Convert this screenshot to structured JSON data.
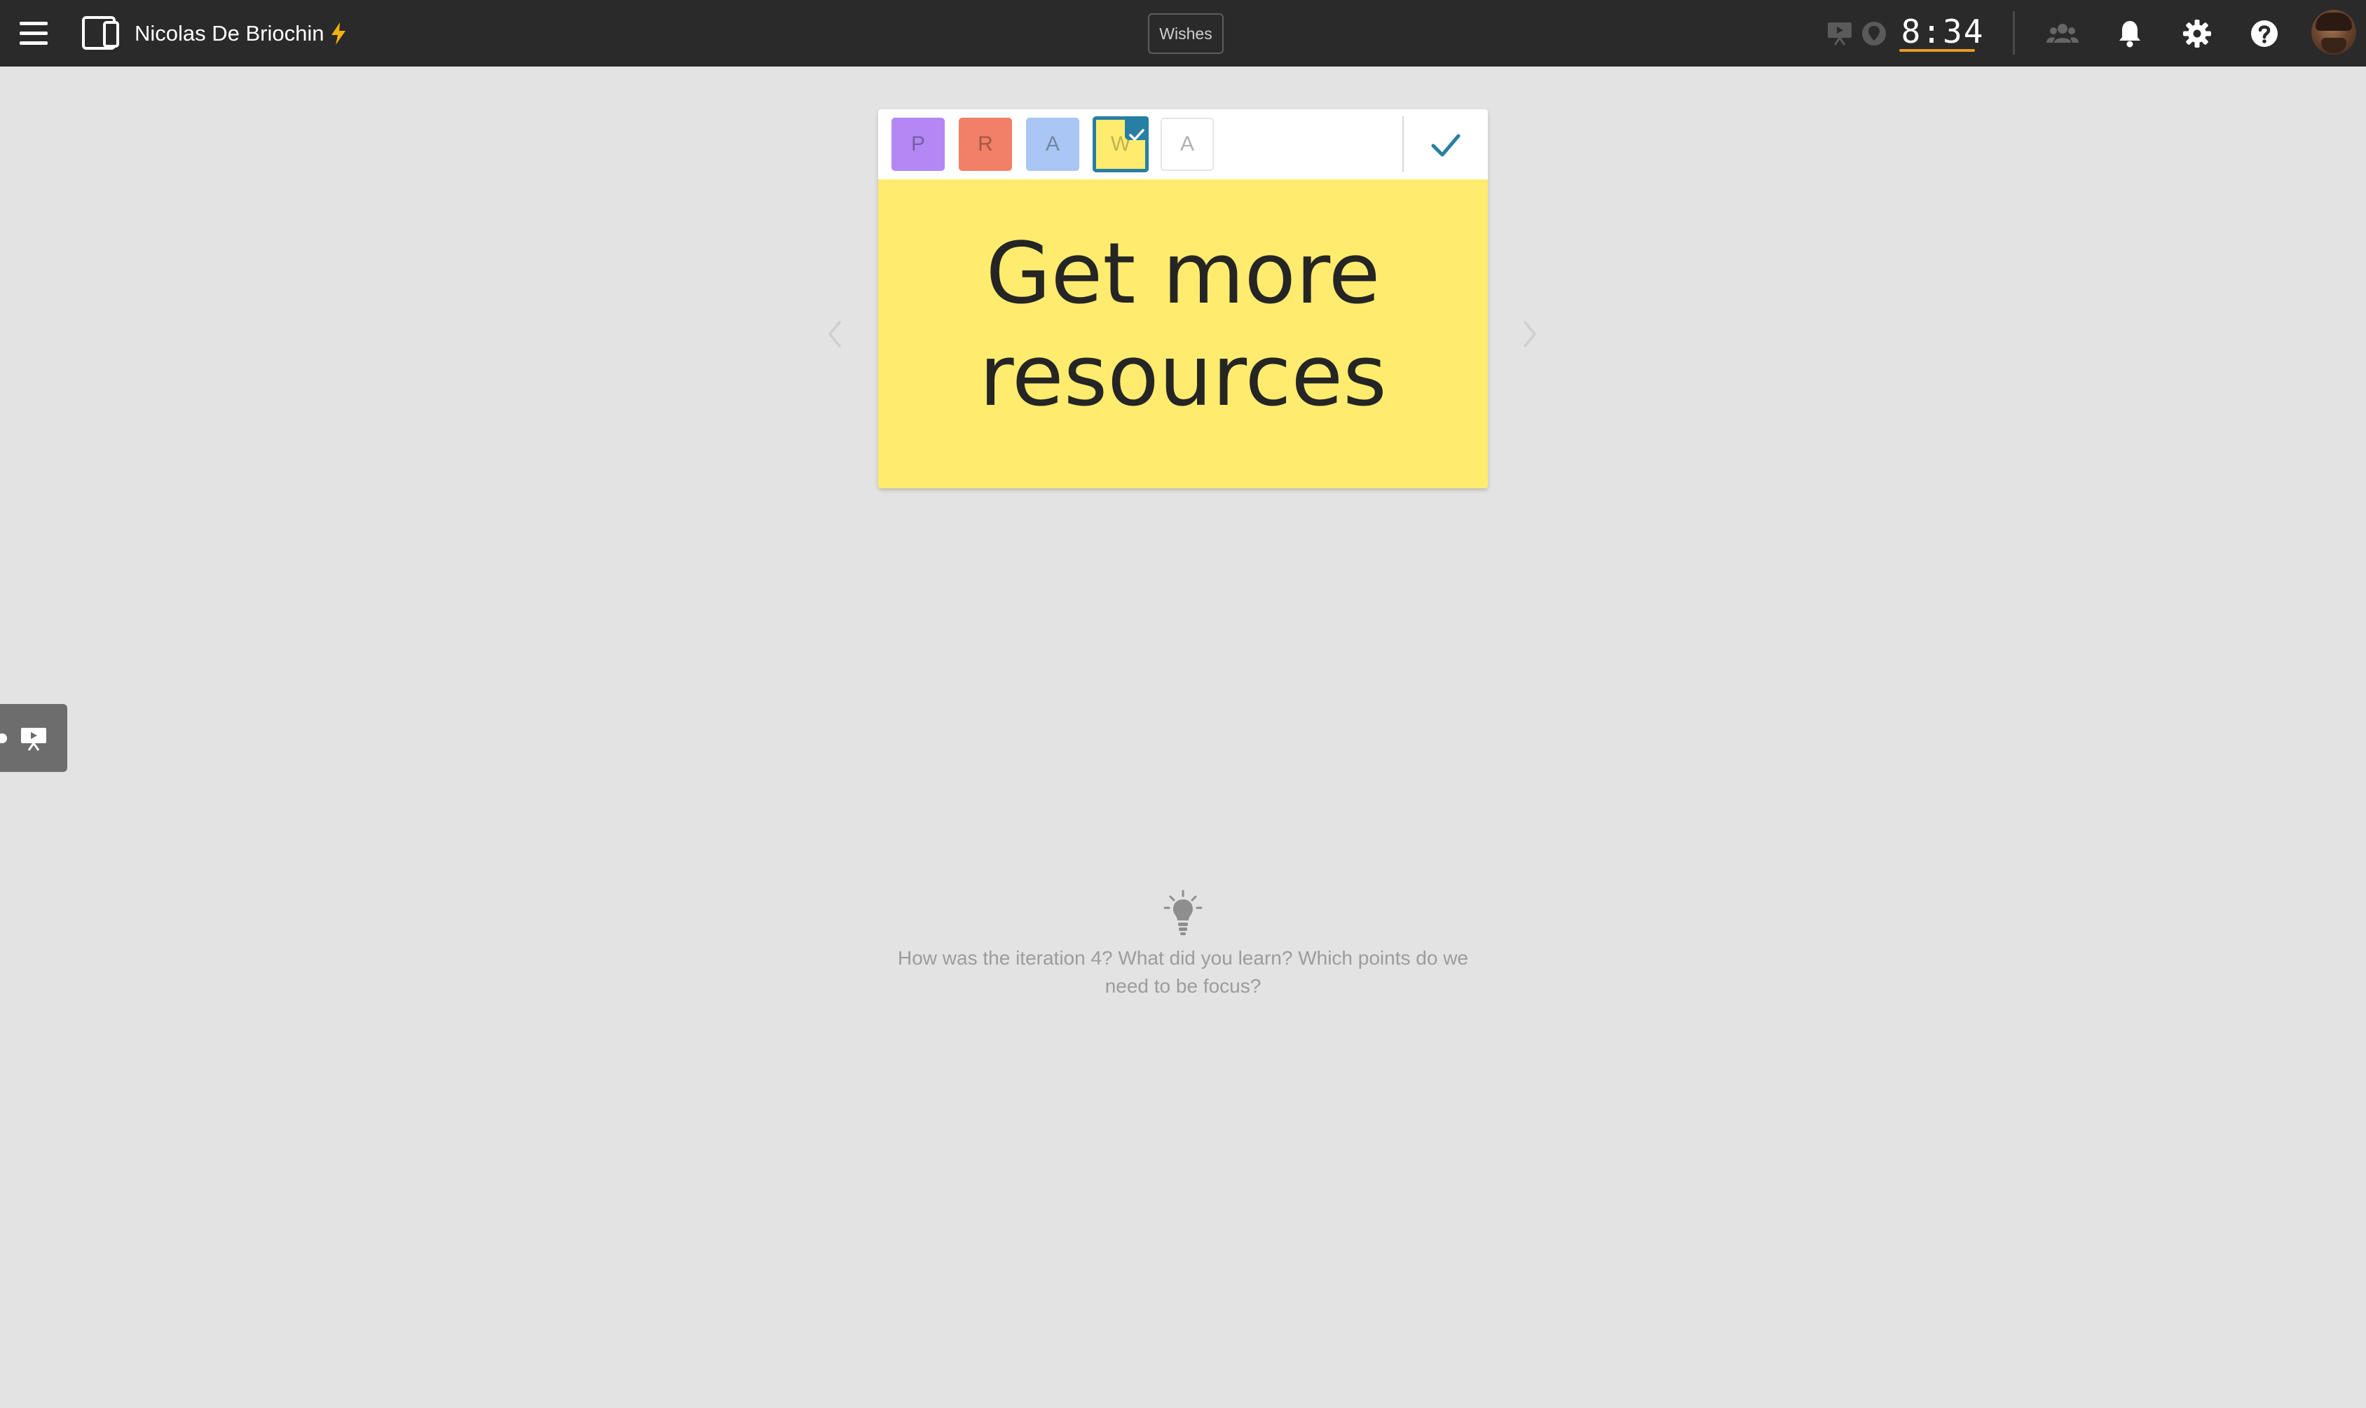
{
  "header": {
    "board_title": "Nicolas De Briochin",
    "column_name": "Wishes",
    "timer": "8:34",
    "icons": [
      "menu-icon",
      "device-icon",
      "bolt-icon",
      "presentation-icon",
      "marker-icon",
      "team-icon",
      "bell-icon",
      "gear-icon",
      "help-icon"
    ],
    "colors": {
      "bar": "#2a2a2a",
      "timer_underline": "#e89a2c",
      "bolt": "#f5b20f"
    }
  },
  "editor": {
    "swatches": [
      {
        "letter": "P",
        "color": "#b388f5"
      },
      {
        "letter": "R",
        "color": "#f18067"
      },
      {
        "letter": "A",
        "color": "#a9c6f4"
      },
      {
        "letter": "W",
        "color": "#ffec6e",
        "selected": true
      },
      {
        "letter": "A",
        "color": "#ffffff"
      }
    ],
    "note_text": "Get more resources",
    "accent": "#277fa3"
  },
  "empty_state": {
    "hint": "How was the iteration 4? What did you learn? Which points do we need to be focus?"
  }
}
